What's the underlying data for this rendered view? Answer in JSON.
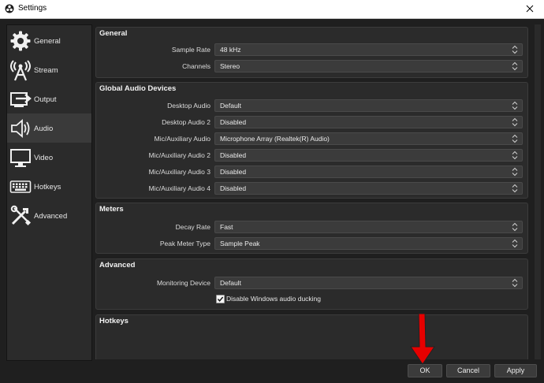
{
  "window": {
    "title": "Settings",
    "app_icon": "obs-logo-icon",
    "close_icon": "close-icon"
  },
  "sidebar": {
    "items": [
      {
        "label": "General",
        "icon": "gear-icon"
      },
      {
        "label": "Stream",
        "icon": "broadcast-antenna-icon"
      },
      {
        "label": "Output",
        "icon": "output-arrow-icon"
      },
      {
        "label": "Audio",
        "icon": "speaker-icon"
      },
      {
        "label": "Video",
        "icon": "monitor-icon"
      },
      {
        "label": "Hotkeys",
        "icon": "keyboard-icon"
      },
      {
        "label": "Advanced",
        "icon": "tools-icon"
      }
    ],
    "active": "Audio"
  },
  "general": {
    "title": "General",
    "rows": [
      {
        "label": "Sample Rate",
        "value": "48 kHz"
      },
      {
        "label": "Channels",
        "value": "Stereo"
      }
    ]
  },
  "global_audio": {
    "title": "Global Audio Devices",
    "rows": [
      {
        "label": "Desktop Audio",
        "value": "Default"
      },
      {
        "label": "Desktop Audio 2",
        "value": "Disabled"
      },
      {
        "label": "Mic/Auxiliary Audio",
        "value": "Microphone Array (Realtek(R) Audio)"
      },
      {
        "label": "Mic/Auxiliary Audio 2",
        "value": "Disabled"
      },
      {
        "label": "Mic/Auxiliary Audio 3",
        "value": "Disabled"
      },
      {
        "label": "Mic/Auxiliary Audio 4",
        "value": "Disabled"
      }
    ]
  },
  "meters": {
    "title": "Meters",
    "rows": [
      {
        "label": "Decay Rate",
        "value": "Fast"
      },
      {
        "label": "Peak Meter Type",
        "value": "Sample Peak"
      }
    ]
  },
  "advanced": {
    "title": "Advanced",
    "rows": [
      {
        "label": "Monitoring Device",
        "value": "Default"
      }
    ],
    "ducking_label": "Disable Windows audio ducking",
    "ducking_checked": true
  },
  "hotkeys": {
    "title": "Hotkeys"
  },
  "buttons": {
    "ok": "OK",
    "cancel": "Cancel",
    "apply": "Apply"
  },
  "colors": {
    "background": "#1f1f1f",
    "panel": "#2b2b2b",
    "field": "#3b3b3b",
    "annotation_arrow": "#e60000"
  }
}
